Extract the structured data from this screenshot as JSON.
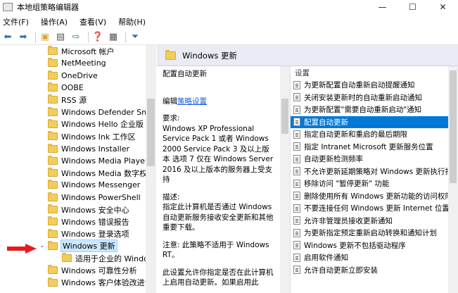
{
  "window": {
    "title": "本地组策略编辑器",
    "minimize": "—",
    "maximize": "☐",
    "close": "✕"
  },
  "menu": [
    "文件(F)",
    "操作(A)",
    "查看(V)",
    "帮助(H)"
  ],
  "tree": {
    "items": [
      {
        "label": "Microsoft 帐户",
        "indent": 1
      },
      {
        "label": "NetMeeting",
        "indent": 1
      },
      {
        "label": "OneDrive",
        "indent": 1
      },
      {
        "label": "OOBE",
        "indent": 1
      },
      {
        "label": "RSS 源",
        "indent": 1
      },
      {
        "label": "Windows Defender Sma",
        "indent": 1
      },
      {
        "label": "Windows Hello 企业版",
        "indent": 1
      },
      {
        "label": "Windows Ink 工作区",
        "indent": 1
      },
      {
        "label": "Windows Installer",
        "indent": 1
      },
      {
        "label": "Windows Media Player",
        "indent": 1
      },
      {
        "label": "Windows Media 数字权",
        "indent": 1
      },
      {
        "label": "Windows Messenger",
        "indent": 1
      },
      {
        "label": "Windows PowerShell",
        "indent": 1
      },
      {
        "label": "Windows 安全中心",
        "indent": 1
      },
      {
        "label": "Windows 错误报告",
        "indent": 1
      },
      {
        "label": "Windows 登录选项",
        "indent": 1
      },
      {
        "label": "Windows 更新",
        "indent": 1,
        "selected": true,
        "expanded": true
      },
      {
        "label": "适用于企业的 Windo",
        "indent": 2
      },
      {
        "label": "Windows 可靠性分析",
        "indent": 1
      },
      {
        "label": "Windows 客户体验改进计",
        "indent": 1
      }
    ],
    "pointer_color": "#e51c1c"
  },
  "panel": {
    "title": "Windows 更新",
    "setting_title": "配置自动更新",
    "edit_prefix": "编辑",
    "edit_link": "策略设置",
    "requirements_label": "要求:",
    "requirements_text": "Windows XP Professional Service Pack 1 或者 Windows 2000 Service Pack 3 及以上版本 选项 7 仅在 Windows Server 2016 及以上版本的服务器上受支持",
    "description_label": "描述:",
    "description_text": "指定此计算机是否通过 Windows 自动更新服务接收安全更新和其他重要下载。",
    "note_text": "注意: 此策略不适用于 Windows RT。",
    "more_text": "此设置允许你指定是否在此计算机上启用自动更新。如果启用此"
  },
  "list": {
    "header": "设置",
    "items": [
      {
        "label": "为更新配置自动重新启动提醒通知"
      },
      {
        "label": "关闭安装更新时的自动重新启动通知"
      },
      {
        "label": "为更新配置\"需要自动重新启动\"通知"
      },
      {
        "label": "配置自动更新",
        "selected": true
      },
      {
        "label": "指定自动更新和重启的最后期限"
      },
      {
        "label": "指定 Intranet Microsoft 更新服务位置"
      },
      {
        "label": "自动更新检测频率"
      },
      {
        "label": "不允许更新延期策略对 Windows 更新执行扫"
      },
      {
        "label": "移除访问 \"暂停更新\" 功能"
      },
      {
        "label": "删除使用所有 Windows 更新功能的访问权限"
      },
      {
        "label": "不要连接任何 Windows 更新 Internet 位置"
      },
      {
        "label": "允许非管理员接收更新通知"
      },
      {
        "label": "为更新指定预定重新启动转换和通知计划"
      },
      {
        "label": "Windows 更新不包括驱动程序"
      },
      {
        "label": "启用软件通知"
      },
      {
        "label": "允许自动更新立即安装"
      }
    ]
  }
}
